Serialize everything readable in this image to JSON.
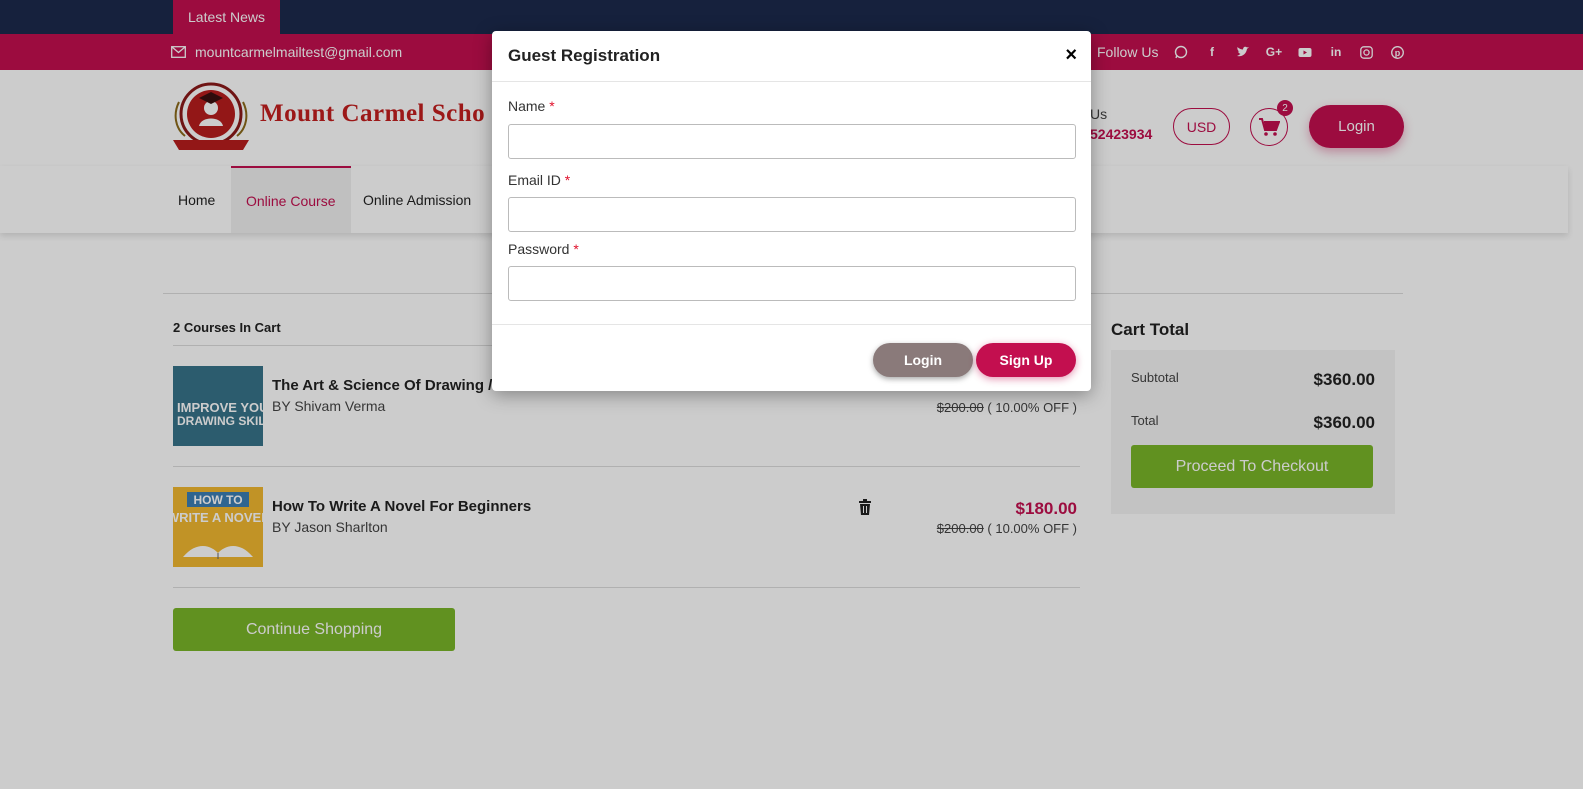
{
  "top_bar": {
    "news_label": "Latest News"
  },
  "contact_bar": {
    "email": "mountcarmelmailtest@gmail.com",
    "follow_label": "Follow Us",
    "social_icons": [
      "whatsapp-icon",
      "facebook-icon",
      "twitter-icon",
      "google-plus-icon",
      "youtube-icon",
      "linkedin-icon",
      "instagram-icon",
      "pinterest-icon"
    ]
  },
  "header": {
    "brand_name": "Mount Carmel Scho",
    "call_label": "Us",
    "call_number": "52423934",
    "currency": "USD",
    "cart_count": "2",
    "login_label": "Login"
  },
  "nav": {
    "items": [
      {
        "label": "Home"
      },
      {
        "label": "Online Course"
      },
      {
        "label": "Online Admission"
      }
    ]
  },
  "cart": {
    "heading": "2 Courses In Cart",
    "items": [
      {
        "title": "The Art & Science Of Drawing /",
        "by": "BY Shivam Verma",
        "price": "",
        "original_price": "$200.00",
        "discount": "( 10.00% OFF )"
      },
      {
        "title": "How To Write A Novel For Beginners",
        "by": "BY Jason Sharlton",
        "price": "$180.00",
        "original_price": "$200.00",
        "discount": "( 10.00% OFF )"
      }
    ],
    "continue_label": "Continue Shopping"
  },
  "cart_total": {
    "title": "Cart Total",
    "subtotal_label": "Subtotal",
    "subtotal_value": "$360.00",
    "total_label": "Total",
    "total_value": "$360.00",
    "checkout_label": "Proceed To Checkout"
  },
  "modal": {
    "title": "Guest Registration",
    "close": "×",
    "fields": [
      {
        "label": "Name",
        "value": ""
      },
      {
        "label": "Email ID",
        "value": ""
      },
      {
        "label": "Password",
        "value": ""
      }
    ],
    "required_mark": "*",
    "login_label": "Login",
    "signup_label": "Sign Up"
  },
  "colors": {
    "primary": "#c30f4f",
    "navy": "#1c2a4d",
    "green": "#7ab628"
  }
}
